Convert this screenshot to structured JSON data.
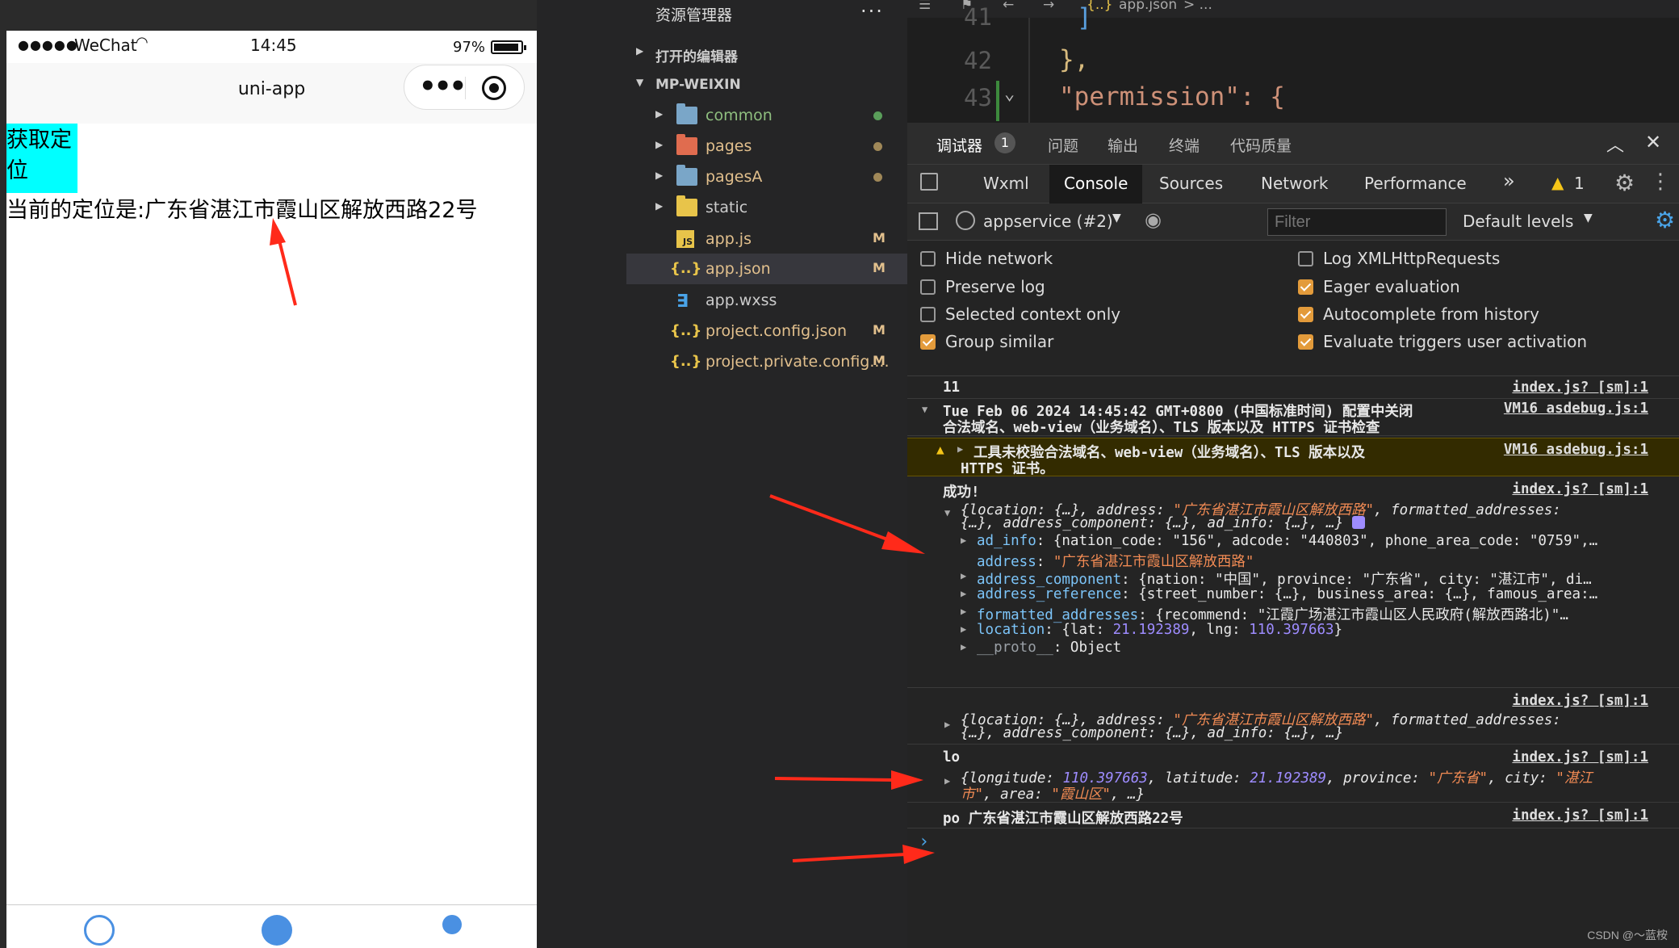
{
  "simulator": {
    "signal": "●●●●●",
    "carrier": "WeChat",
    "time": "14:45",
    "battery": "97%",
    "nav_title": "uni-app",
    "button_label": "获取定位",
    "location_text": "当前的定位是:广东省湛江市霞山区解放西路22号"
  },
  "explorer": {
    "title": "资源管理器",
    "more": "···",
    "section_open": "打开的编辑器",
    "section_project": "MP-WEIXIN",
    "items": [
      {
        "name": "common",
        "status": ""
      },
      {
        "name": "pages",
        "status": ""
      },
      {
        "name": "pagesA",
        "status": ""
      },
      {
        "name": "static",
        "status": ""
      },
      {
        "name": "app.js",
        "status": "M"
      },
      {
        "name": "app.json",
        "status": "M"
      },
      {
        "name": "app.wxss",
        "status": ""
      },
      {
        "name": "project.config.json",
        "status": "M"
      },
      {
        "name": "project.private.config....",
        "status": "M"
      }
    ]
  },
  "editor": {
    "breadcrumb": "app.json",
    "breadcrumb_more": "> ...",
    "lines": [
      {
        "no": "41",
        "code": "]"
      },
      {
        "no": "42",
        "code": "},"
      },
      {
        "no": "43",
        "code": "\"permission\": {"
      }
    ]
  },
  "devtools": {
    "top_tabs": [
      "调试器",
      "问题",
      "输出",
      "终端",
      "代码质量"
    ],
    "debugger_badge": "1",
    "panel_tabs": [
      "Wxml",
      "Console",
      "Sources",
      "Network",
      "Performance"
    ],
    "more_tabs": "»",
    "warning_count": "1",
    "context": "appservice (#2)",
    "filter_placeholder": "Filter",
    "levels": "Default levels",
    "options_left": [
      {
        "label": "Hide network",
        "checked": false
      },
      {
        "label": "Preserve log",
        "checked": false
      },
      {
        "label": "Selected context only",
        "checked": false
      },
      {
        "label": "Group similar",
        "checked": true
      }
    ],
    "options_right": [
      {
        "label": "Log XMLHttpRequests",
        "checked": false
      },
      {
        "label": "Eager evaluation",
        "checked": true
      },
      {
        "label": "Autocomplete from history",
        "checked": true
      },
      {
        "label": "Evaluate triggers user activation",
        "checked": true
      }
    ],
    "console": {
      "r1_msg": "11",
      "src_index": "index.js? [sm]:1",
      "src_vm": "VM16 asdebug.js:1",
      "r2_line1": "Tue Feb 06 2024 14:45:42 GMT+0800 (中国标准时间) 配置中关闭",
      "r2_line2": "合法域名、web-view（业务域名）、TLS 版本以及 HTTPS 证书检查",
      "r3_line1": "工具未校验合法域名、web-view（业务域名）、TLS 版本以及",
      "r3_line2": "HTTPS 证书。",
      "r4_title": "成功!",
      "address_val": "\"广东省湛江市霞山区解放西路\"",
      "ad_info": "{nation_code: \"156\", adcode: \"440803\", phone_area_code: \"0759\",…",
      "addr_component": "{nation: \"中国\", province: \"广东省\", city: \"湛江市\", di…",
      "addr_reference": "{street_number: {…}, business_area: {…}, famous_area:…",
      "formatted": "{recommend: \"江霞广场湛江市霞山区人民政府(解放西路北)\"…",
      "lat": "21.192389",
      "lng": "110.397663",
      "proto": "Object",
      "r6_title": "lo",
      "longitude": "110.397663",
      "latitude": "21.192389",
      "province": "\"广东省\"",
      "city1": "\"湛江",
      "city2": "市\"",
      "area": "\"霞山区\"",
      "r7_msg": "po 广东省湛江市霞山区解放西路22号"
    },
    "watermark": "CSDN @～蓝桉"
  }
}
